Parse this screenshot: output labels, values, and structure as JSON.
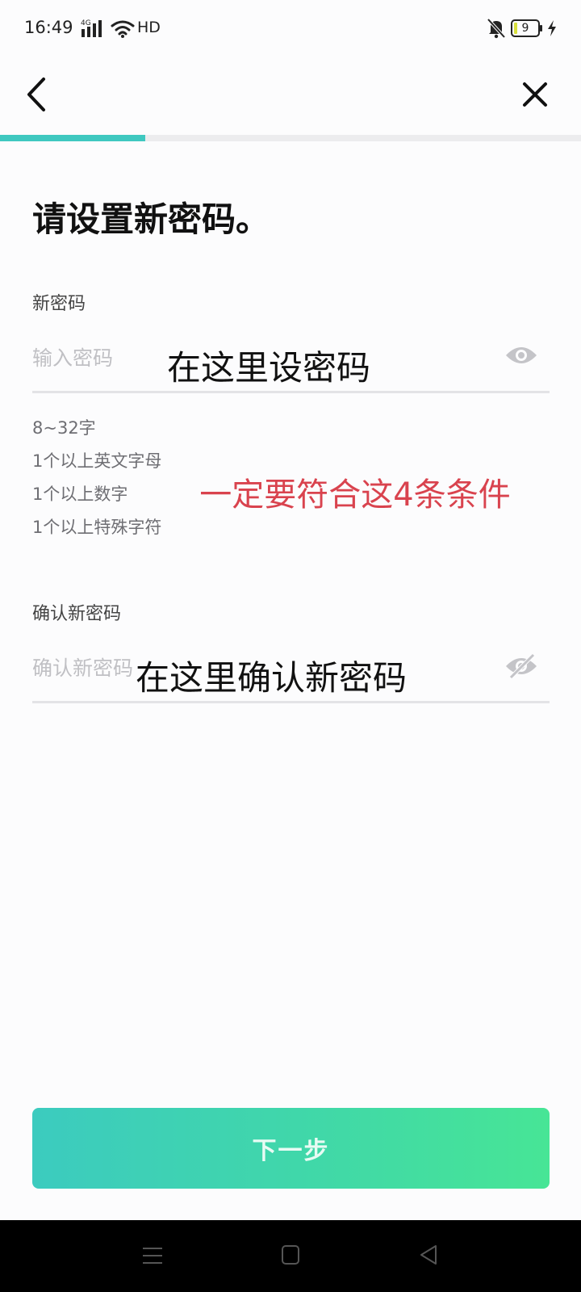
{
  "status_bar": {
    "time": "16:49",
    "network": "4G",
    "hd": "HD",
    "battery_level": "9",
    "icons": [
      "signal-icon",
      "wifi-icon",
      "bell-off-icon",
      "battery-icon",
      "charge-icon"
    ]
  },
  "nav": {
    "icons": [
      "back-icon",
      "close-icon"
    ]
  },
  "progress": {
    "value": 0.25,
    "color": "#3fc8c0"
  },
  "title": "请设置新密码。",
  "new_password": {
    "label": "新密码",
    "placeholder": "输入密码",
    "value": "",
    "annotation": "在这里设密码",
    "icon": "eye-icon"
  },
  "rules": [
    "8~32字",
    "1个以上英文字母",
    "1个以上数字",
    "1个以上特殊字符"
  ],
  "rules_annotation": "一定要符合这4条条件",
  "confirm_password": {
    "label": "确认新密码",
    "placeholder": "确认新密码",
    "value": "",
    "annotation": "在这里确认新密码",
    "icon": "eye-off-icon"
  },
  "next_button": {
    "label": "下一步"
  },
  "colors": {
    "accent": "#3fc8c0",
    "button_gradient_start": "#3ccbbf",
    "button_gradient_end": "#47e596",
    "annotation_red": "#d9434e"
  },
  "system_nav": {
    "icons": [
      "menu-icon",
      "home-icon",
      "back-triangle-icon"
    ]
  }
}
